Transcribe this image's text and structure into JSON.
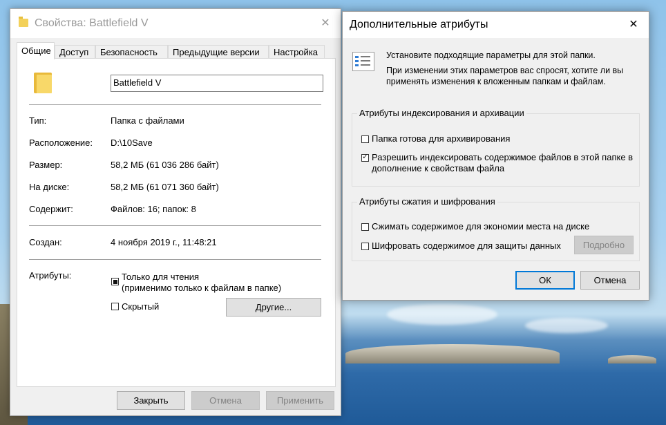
{
  "props": {
    "title": "Свойства: Battlefield V",
    "close_glyph": "✕",
    "tabs": [
      "Общие",
      "Доступ",
      "Безопасность",
      "Предыдущие версии",
      "Настройка"
    ],
    "folder_name": "Battlefield V",
    "rows": {
      "type_label": "Тип:",
      "type_value": "Папка с файлами",
      "location_label": "Расположение:",
      "location_value": "D:\\10Save",
      "size_label": "Размер:",
      "size_value": "58,2 МБ (61 036 286 байт)",
      "disk_label": "На диске:",
      "disk_value": "58,2 МБ (61 071 360 байт)",
      "contains_label": "Содержит:",
      "contains_value": "Файлов: 16; папок: 8",
      "created_label": "Создан:",
      "created_value": "4 ноября 2019 г., 11:48:21",
      "attributes_label": "Атрибуты:"
    },
    "readonly_label": "Только для чтения",
    "readonly_note": "(применимо только к файлам в папке)",
    "hidden_label": "Скрытый",
    "other_button": "Другие...",
    "close_button": "Закрыть",
    "cancel_button": "Отмена",
    "apply_button": "Применить"
  },
  "advanced": {
    "title": "Дополнительные атрибуты",
    "close_glyph": "✕",
    "info_line1": "Установите подходящие параметры для этой папки.",
    "info_line2": "При изменении этих параметров вас спросят, хотите ли вы",
    "info_line3": "применять изменения к вложенным папкам и файлам.",
    "index_group_title": "Атрибуты индексирования и архивации",
    "archive_label": "Папка готова для архивирования",
    "archive_checked": false,
    "index_label_line1": "Разрешить индексировать содержимое файлов в этой папке в",
    "index_label_line2": "дополнение к свойствам файла",
    "index_checked": true,
    "compress_group_title": "Атрибуты сжатия и шифрования",
    "compress_label": "Сжимать содержимое для экономии места на диске",
    "compress_checked": false,
    "encrypt_label": "Шифровать содержимое для защиты данных",
    "encrypt_checked": false,
    "details_button": "Подробно",
    "ok_button": "ОК",
    "cancel_button": "Отмена"
  },
  "colors": {
    "accent": "#0078d7",
    "folder": "#f8d869",
    "disabled_text": "#838383"
  }
}
